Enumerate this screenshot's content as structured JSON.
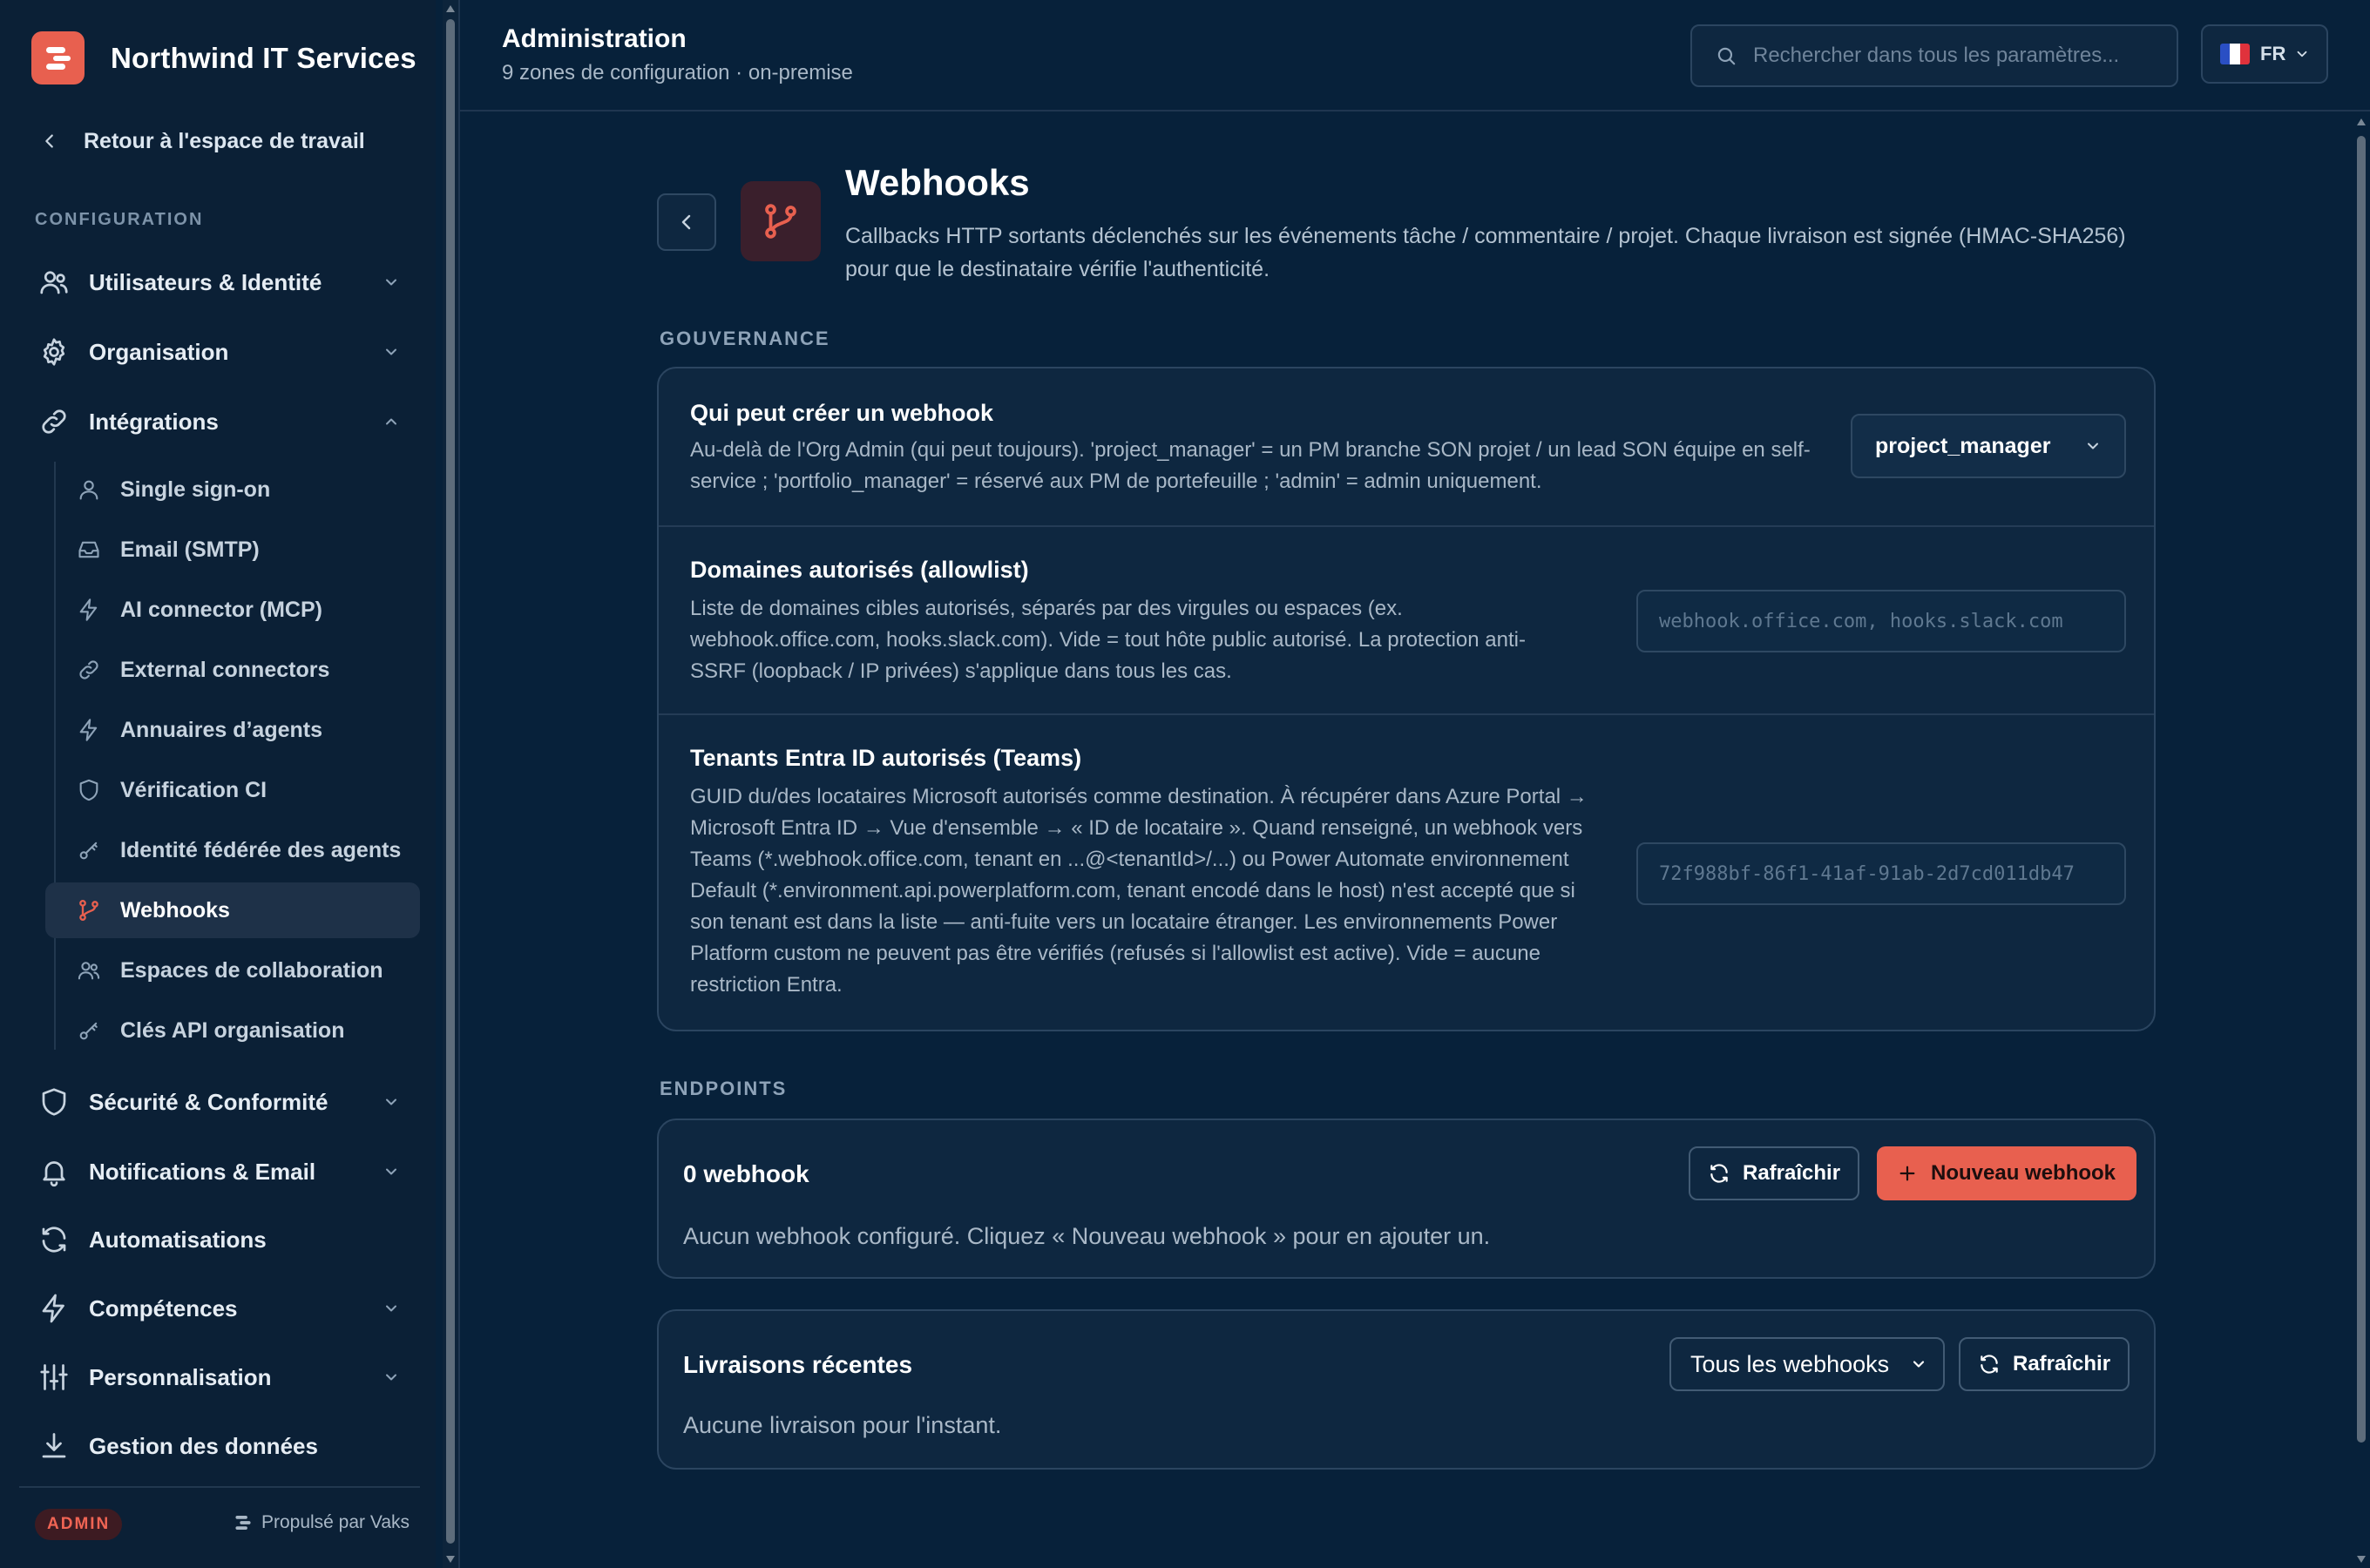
{
  "brand": {
    "name": "Northwind IT Services",
    "logo_color": "#e8604f"
  },
  "sidebar": {
    "back_label": "Retour à l'espace de travail",
    "section_label": "CONFIGURATION",
    "groups": [
      {
        "label": "Utilisateurs & Identité",
        "icon": "users-icon",
        "expanded": false
      },
      {
        "label": "Organisation",
        "icon": "gear-icon",
        "expanded": false
      },
      {
        "label": "Intégrations",
        "icon": "link-icon",
        "expanded": true
      },
      {
        "label": "Sécurité & Conformité",
        "icon": "shield-icon",
        "expanded": false
      },
      {
        "label": "Notifications & Email",
        "icon": "bell-icon",
        "expanded": false
      },
      {
        "label": "Automatisations",
        "icon": "refresh-icon",
        "expanded": false
      },
      {
        "label": "Compétences",
        "icon": "bolt-icon",
        "expanded": false
      },
      {
        "label": "Personnalisation",
        "icon": "sliders-icon",
        "expanded": false
      },
      {
        "label": "Gestion des données",
        "icon": "download-icon",
        "expanded": false
      }
    ],
    "integrations_items": [
      {
        "label": "Single sign-on",
        "icon": "user-icon"
      },
      {
        "label": "Email (SMTP)",
        "icon": "inbox-icon"
      },
      {
        "label": "AI connector (MCP)",
        "icon": "bolt-icon"
      },
      {
        "label": "External connectors",
        "icon": "link-icon"
      },
      {
        "label": "Annuaires d’agents",
        "icon": "bolt-icon"
      },
      {
        "label": "Vérification CI",
        "icon": "shield-icon"
      },
      {
        "label": "Identité fédérée des agents",
        "icon": "key-icon"
      },
      {
        "label": "Webhooks",
        "icon": "git-branch-icon",
        "active": true
      },
      {
        "label": "Espaces de collaboration",
        "icon": "users-icon"
      },
      {
        "label": "Clés API organisation",
        "icon": "key-icon"
      }
    ],
    "footer": {
      "badge": "ADMIN",
      "powered_by": "Propulsé par Vaks"
    }
  },
  "header": {
    "title": "Administration",
    "subtitle": "9 zones de configuration · on-premise",
    "search_placeholder": "Rechercher dans tous les paramètres...",
    "language": "FR"
  },
  "page": {
    "title": "Webhooks",
    "description": "Callbacks HTTP sortants déclenchés sur les événements tâche / commentaire / projet. Chaque livraison est signée (HMAC-SHA256) pour que le destinataire vérifie l'authenticité.",
    "icon": "git-branch-icon"
  },
  "governance": {
    "label": "GOUVERNANCE",
    "who_can_create": {
      "title": "Qui peut créer un webhook",
      "description": "Au-delà de l'Org Admin (qui peut toujours). 'project_manager' = un PM branche SON projet / un lead SON équipe en self-service ; 'portfolio_manager' = réservé aux PM de portefeuille ; 'admin' = admin uniquement.",
      "value": "project_manager"
    },
    "domains": {
      "title": "Domaines autorisés (allowlist)",
      "description": "Liste de domaines cibles autorisés, séparés par des virgules ou espaces (ex. webhook.office.com, hooks.slack.com). Vide = tout hôte public autorisé. La protection anti-SSRF (loopback / IP privées) s'applique dans tous les cas.",
      "placeholder": "webhook.office.com, hooks.slack.com"
    },
    "tenants": {
      "title": "Tenants Entra ID autorisés (Teams)",
      "description": "GUID du/des locataires Microsoft autorisés comme destination. À récupérer dans Azure Portal → Microsoft Entra ID → Vue d'ensemble → « ID de locataire ». Quand renseigné, un webhook vers Teams (*.webhook.office.com, tenant en ...@<tenantId>/...) ou Power Automate environnement Default (*.environment.api.powerplatform.com, tenant encodé dans le host) n'est accepté que si son tenant est dans la liste — anti-fuite vers un locataire étranger. Les environnements Power Platform custom ne peuvent pas être vérifiés (refusés si l'allowlist est active). Vide = aucune restriction Entra.",
      "placeholder": "72f988bf-86f1-41af-91ab-2d7cd011db47"
    }
  },
  "endpoints": {
    "label": "ENDPOINTS",
    "count_label": "0 webhook",
    "refresh_label": "Rafraîchir",
    "new_label": "Nouveau webhook",
    "empty": "Aucun webhook configuré. Cliquez « Nouveau webhook » pour en ajouter un."
  },
  "deliveries": {
    "title": "Livraisons récentes",
    "filter_value": "Tous les webhooks",
    "refresh_label": "Rafraîchir",
    "empty": "Aucune livraison pour l'instant."
  }
}
